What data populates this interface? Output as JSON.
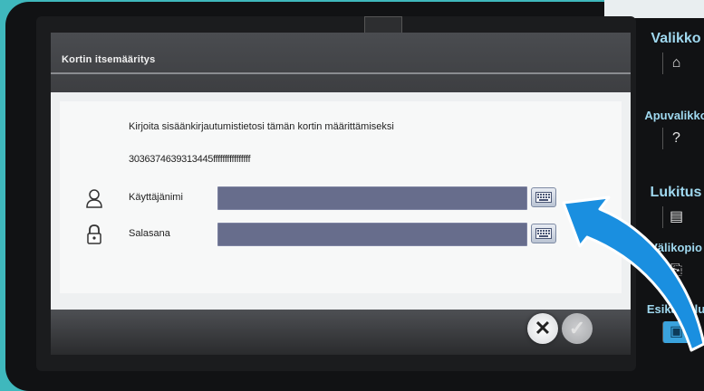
{
  "dialog": {
    "title": "Kortin itsemääritys",
    "prompt": "Kirjoita sisäänkirjautumistietosi tämän kortin määrittämiseksi",
    "card_id": "3036374639313445ffffffffffffffff",
    "username_label": "Käyttäjänimi",
    "password_label": "Salasana",
    "username_value": "",
    "password_value": ""
  },
  "buttons": {
    "cancel": "✕",
    "ok": "✓"
  },
  "side_menu": {
    "menu": "Valikko",
    "help": "Apuvalikko",
    "lock": "Lukitus",
    "clipboard": "Välikopio",
    "preview": "Esikatselu"
  },
  "colors": {
    "field": "#676d8c",
    "side_text": "#9fd8ef",
    "arrow": "#1a8fe0"
  }
}
